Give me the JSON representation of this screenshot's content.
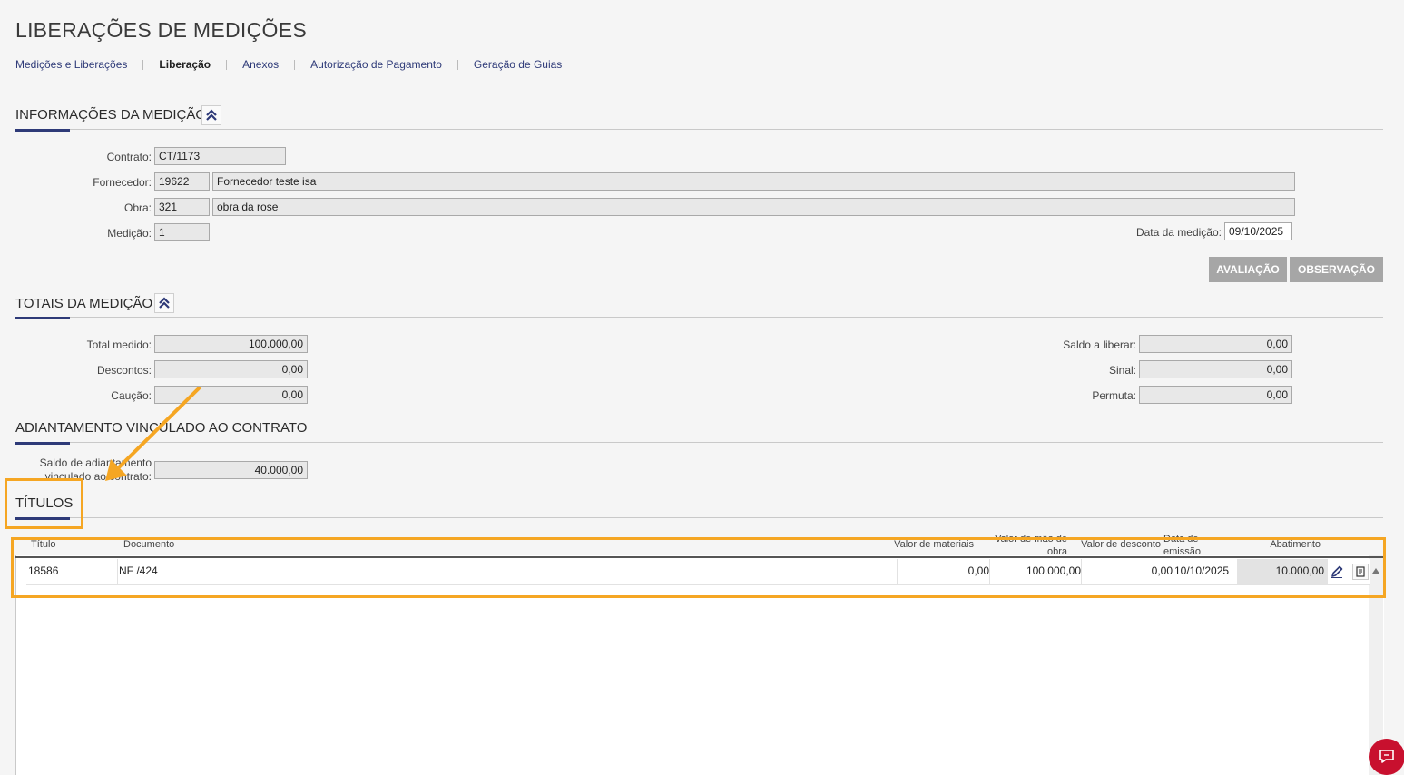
{
  "page": {
    "title": "LIBERAÇÕES DE MEDIÇÕES"
  },
  "nav": {
    "items": [
      {
        "label": "Medições e Liberações"
      },
      {
        "label": "Liberação"
      },
      {
        "label": "Anexos"
      },
      {
        "label": "Autorização de Pagamento"
      },
      {
        "label": "Geração de Guias"
      }
    ],
    "active": "Liberação"
  },
  "info": {
    "title": "INFORMAÇÕES DA MEDIÇÃO",
    "contrato_label": "Contrato:",
    "contrato_value": "CT/1173",
    "fornecedor_label": "Fornecedor:",
    "fornecedor_code": "19622",
    "fornecedor_name": "Fornecedor teste isa",
    "obra_label": "Obra:",
    "obra_code": "321",
    "obra_name": "obra da rose",
    "medicao_label": "Medição:",
    "medicao_value": "1",
    "data_label": "Data da medição:",
    "data_value": "09/10/2025",
    "btn_avaliacao": "AVALIAÇÃO",
    "btn_observacao": "OBSERVAÇÃO"
  },
  "totais": {
    "title": "TOTAIS DA MEDIÇÃO",
    "total_medido_label": "Total medido:",
    "total_medido_value": "100.000,00",
    "descontos_label": "Descontos:",
    "descontos_value": "0,00",
    "caucao_label": "Caução:",
    "caucao_value": "0,00",
    "saldo_label": "Saldo a liberar:",
    "saldo_value": "0,00",
    "sinal_label": "Sinal:",
    "sinal_value": "0,00",
    "permuta_label": "Permuta:",
    "permuta_value": "0,00"
  },
  "adiantamento": {
    "title": "ADIANTAMENTO VINCULADO AO CONTRATO",
    "saldo_label_1": "Saldo de adiantamento",
    "saldo_label_2": "vinculado ao contrato:",
    "saldo_value": "40.000,00"
  },
  "titulos": {
    "title": "TÍTULOS",
    "columns": {
      "titulo": "Título",
      "documento": "Documento",
      "valor_materiais": "Valor de materiais",
      "valor_mao_obra_1": "Valor de mão de",
      "valor_mao_obra_2": "obra",
      "valor_desconto": "Valor de desconto",
      "data_emissao_1": "Data de",
      "data_emissao_2": "emissão",
      "abatimento": "Abatimento"
    },
    "rows": [
      {
        "titulo": "18586",
        "documento": "NF /424",
        "valor_materiais": "0,00",
        "valor_mao_obra": "100.000,00",
        "valor_desconto": "0,00",
        "data_emissao": "10/10/2025",
        "abatimento": "10.000,00"
      }
    ]
  },
  "colors": {
    "accent": "#2e3a78",
    "highlight": "#f5a623",
    "button_gray": "#a6a6a6",
    "chat_red": "#c8102e"
  },
  "icons": [
    "chevron-double-up-icon",
    "pencil-icon",
    "document-icon",
    "scroll-up-icon",
    "chat-icon",
    "arrow-annotation"
  ]
}
